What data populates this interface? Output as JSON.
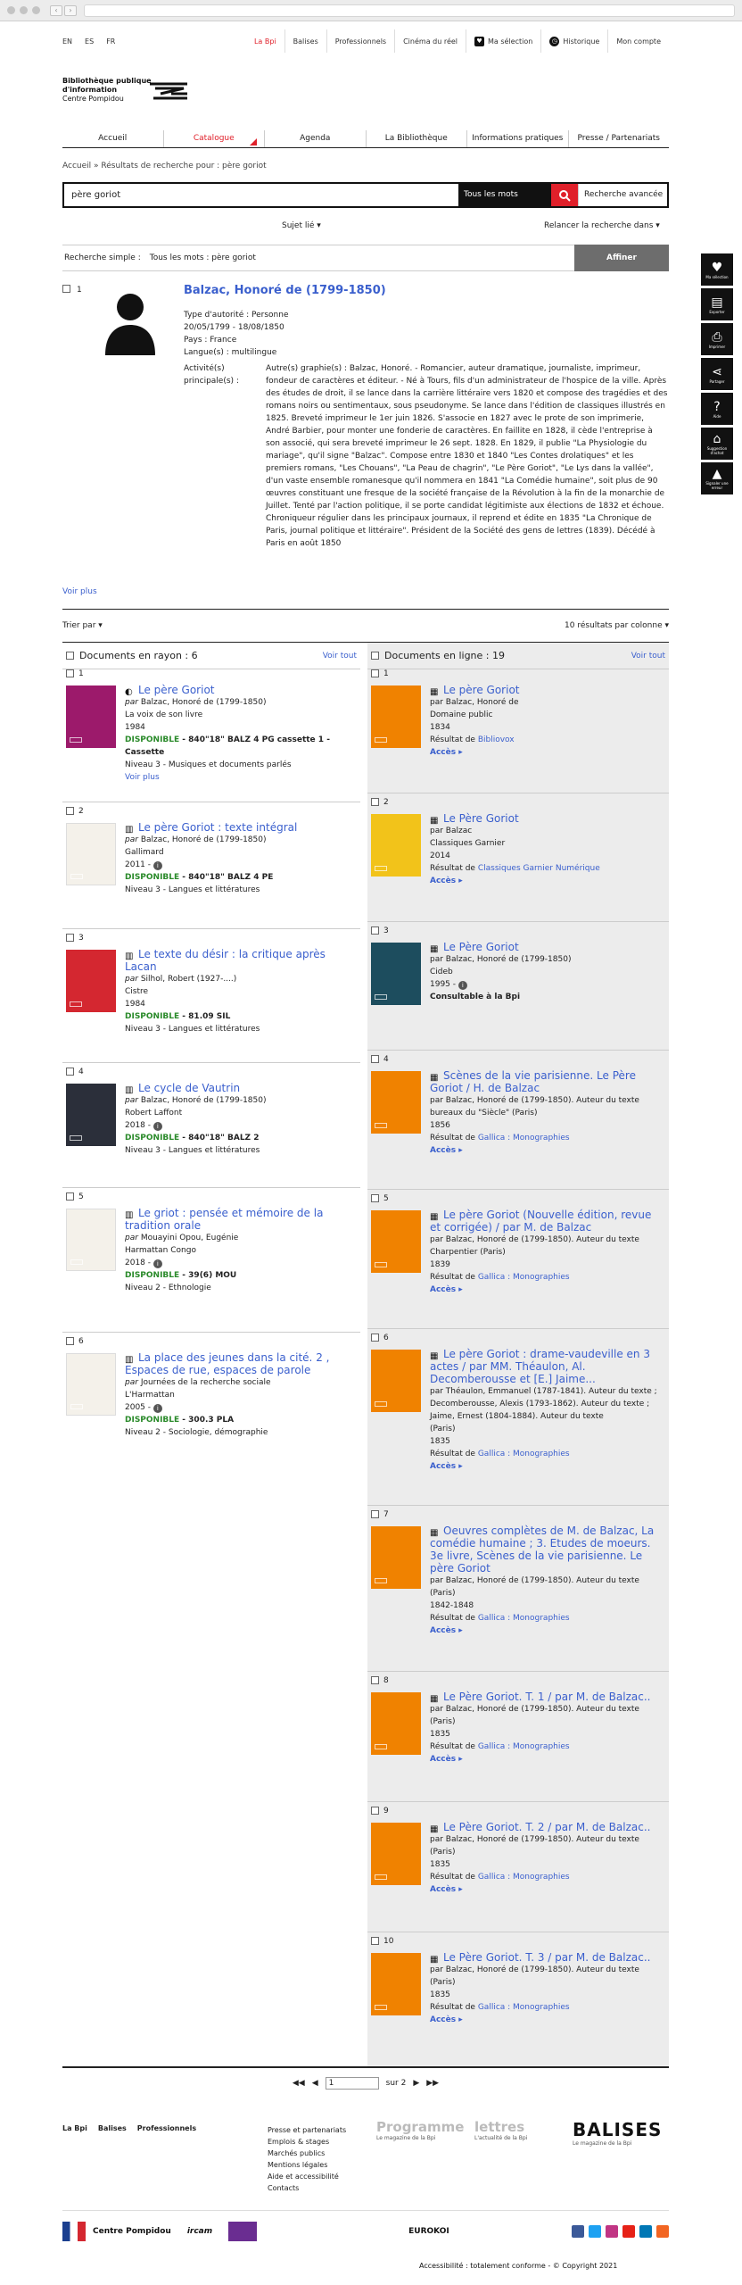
{
  "langs": [
    "EN",
    "ES",
    "FR"
  ],
  "topnav": {
    "items": [
      "La Bpi",
      "Balises",
      "Professionnels",
      "Cinéma du réel"
    ],
    "selection": "Ma sélection",
    "history": "Historique",
    "account": "Mon compte"
  },
  "logo": {
    "line1": "Bibliothèque publique",
    "line2": "d'information",
    "line3": "Centre Pompidou"
  },
  "mainmenu": [
    "Accueil",
    "Catalogue",
    "Agenda",
    "La Bibliothèque",
    "Informations pratiques",
    "Presse / Partenariats"
  ],
  "breadcrumb": "Accueil  »  Résultats de recherche pour : père goriot",
  "search": {
    "query": "père goriot",
    "mode": "Tous les mots",
    "advanced": "Recherche avancée"
  },
  "filters": {
    "subject": "Sujet lié ▾",
    "relaunch": "Relancer la recherche dans ▾"
  },
  "refine": {
    "label": "Recherche simple :",
    "value": "Tous les mots : père goriot",
    "button": "Affiner"
  },
  "sidebar": [
    "Ma sélection",
    "Exporter",
    "Imprimer",
    "Partager",
    "Aide",
    "Suggestion d'achat",
    "Signaler une erreur"
  ],
  "authority": {
    "num": "1",
    "title": "Balzac, Honoré de (1799-1850)",
    "meta": [
      "Type d'autorité : Personne",
      "20/05/1799 - 18/08/1850",
      "Pays : France",
      "Langue(s) : multilingue"
    ],
    "activity_label": "Activité(s) principale(s) :",
    "activity": "Autre(s) graphie(s) : Balzac, Honoré. - Romancier, auteur dramatique, journaliste, imprimeur, fondeur de caractères et éditeur. - Né à Tours, fils d'un administrateur de l'hospice de la ville. Après des études de droit, il se lance dans la carrière littéraire vers 1820 et compose des tragédies et des romans noirs ou sentimentaux, sous pseudonyme. Se lance dans l'édition de classiques illustrés en 1825. Breveté imprimeur le 1er juin 1826. S'associe en 1827 avec le prote de son imprimerie, André Barbier, pour monter une fonderie de caractères. En faillite en 1828, il cède l'entreprise à son associé, qui sera breveté imprimeur le 26 sept. 1828. En 1829, il publie \"La Physiologie du mariage\", qu'il signe \"Balzac\". Compose entre 1830 et 1840 \"Les Contes drolatiques\" et les premiers romans, \"Les Chouans\", \"La Peau de chagrin\", \"Le Père Goriot\", \"Le Lys dans la vallée\", d'un vaste ensemble romanesque qu'il nommera en 1841 \"La Comédie humaine\", soit plus de 90 œuvres constituant une fresque de la société française de la Révolution à la fin de la monarchie de Juillet. Tenté par l'action politique, il se porte candidat légitimiste aux élections de 1832 et échoue. Chroniqueur régulier dans les principaux journaux, il reprend et édite en 1835 \"La Chronique de Paris, journal politique et littéraire\". Président de la Société des gens de lettres (1839). Décédé à Paris en août 1850",
    "more": "Voir plus"
  },
  "sort": {
    "label": "Trier par ▾",
    "per_column": "10 résultats par colonne ▾"
  },
  "left": {
    "title": "Documents en rayon : 6",
    "see_all": "Voir tout",
    "items": [
      {
        "n": "1",
        "title": "Le père Goriot",
        "by": "Balzac, Honoré de (1799-1850)",
        "pub": "La voix de son livre",
        "year": "1984",
        "dispo": "DISPONIBLE",
        "cote": " - 840\"18\" BALZ 4 PG cassette 1 - Cassette",
        "level": "Niveau 3 - Musiques et documents parlés",
        "more": "Voir plus"
      },
      {
        "n": "2",
        "title": "Le père Goriot : texte intégral",
        "by": "Balzac, Honoré de (1799-1850)",
        "pub": "Gallimard",
        "year": "2011 -",
        "dispo": "DISPONIBLE",
        "cote": " - 840\"18\" BALZ 4 PE",
        "level": "Niveau 3 - Langues et littératures"
      },
      {
        "n": "3",
        "title": "Le texte du désir : la critique après Lacan",
        "by": "Silhol, Robert (1927-....)",
        "pub": "Cistre",
        "year": "1984",
        "dispo": "DISPONIBLE",
        "cote": " - 81.09 SIL",
        "level": "Niveau 3 - Langues et littératures"
      },
      {
        "n": "4",
        "title": "Le cycle de Vautrin",
        "by": "Balzac, Honoré de (1799-1850)",
        "pub": "Robert Laffont",
        "year": "2018 -",
        "dispo": "DISPONIBLE",
        "cote": " - 840\"18\" BALZ 2",
        "level": "Niveau 3 - Langues et littératures"
      },
      {
        "n": "5",
        "title": "Le griot : pensée et mémoire de la tradition orale",
        "by": "Mouayini Opou, Eugénie",
        "pub": "Harmattan Congo",
        "year": "2018 -",
        "dispo": "DISPONIBLE",
        "cote": " - 39(6) MOU",
        "level": "Niveau 2 - Ethnologie"
      },
      {
        "n": "6",
        "title": "La place des jeunes dans la cité. 2 , Espaces de rue, espaces de parole",
        "by": "Journées de la recherche sociale",
        "pub": "L'Harmattan",
        "year": "2005 -",
        "dispo": "DISPONIBLE",
        "cote": " - 300.3 PLA",
        "level": "Niveau 2 - Sociologie, démographie"
      }
    ]
  },
  "right": {
    "title": "Documents en ligne : 19",
    "see_all": "Voir tout",
    "items": [
      {
        "n": "1",
        "title": "Le père Goriot",
        "lines": [
          "par Balzac, Honoré de",
          "Domaine public",
          "1834"
        ],
        "src_label": "Résultat de ",
        "src": "Bibliovox",
        "access": "Accès ▸"
      },
      {
        "n": "2",
        "title": "Le Père Goriot",
        "lines": [
          "par Balzac",
          "Classiques Garnier",
          "2014"
        ],
        "src_label": "Résultat de ",
        "src": "Classiques Garnier Numérique",
        "access": "Accès ▸"
      },
      {
        "n": "3",
        "title": "Le Père Goriot",
        "lines": [
          "par Balzac, Honoré de (1799-1850)",
          "Cideb",
          "1995 -"
        ],
        "src_label": "",
        "src": "",
        "access": "Consultable à la Bpi"
      },
      {
        "n": "4",
        "title": "Scènes de la vie parisienne. Le Père Goriot / H. de Balzac",
        "lines": [
          "par Balzac, Honoré de (1799-1850). Auteur du texte",
          "bureaux du \"Siècle\" (Paris)",
          "1856"
        ],
        "src_label": "Résultat de ",
        "src": "Gallica : Monographies",
        "access": "Accès ▸"
      },
      {
        "n": "5",
        "title": "Le père Goriot (Nouvelle édition, revue et corrigée) / par M. de Balzac",
        "lines": [
          "par Balzac, Honoré de (1799-1850). Auteur du texte",
          "Charpentier (Paris)",
          "1839"
        ],
        "src_label": "Résultat de ",
        "src": "Gallica : Monographies",
        "access": "Accès ▸"
      },
      {
        "n": "6",
        "title": "Le père Goriot : drame-vaudeville en 3 actes / par MM. Théaulon, Al. Decomberousse et [E.] Jaime...",
        "lines": [
          "par Théaulon, Emmanuel (1787-1841). Auteur du texte ; Decomberousse, Alexis (1793-1862). Auteur du texte ; Jaime, Ernest (1804-1884). Auteur du texte",
          "(Paris)",
          "1835"
        ],
        "src_label": "Résultat de ",
        "src": "Gallica : Monographies",
        "access": "Accès ▸"
      },
      {
        "n": "7",
        "title": "Oeuvres complètes de M. de Balzac, La comédie humaine ; 3. Etudes de moeurs. 3e livre, Scènes de la vie parisienne. Le père Goriot",
        "lines": [
          "par Balzac, Honoré de (1799-1850). Auteur du texte",
          "(Paris)",
          "1842-1848"
        ],
        "src_label": "Résultat de ",
        "src": "Gallica : Monographies",
        "access": "Accès ▸"
      },
      {
        "n": "8",
        "title": "Le Père Goriot. T. 1 / par M. de Balzac..",
        "lines": [
          "par Balzac, Honoré de (1799-1850). Auteur du texte",
          "(Paris)",
          "1835"
        ],
        "src_label": "Résultat de ",
        "src": "Gallica : Monographies",
        "access": "Accès ▸"
      },
      {
        "n": "9",
        "title": "Le Père Goriot. T. 2 / par M. de Balzac..",
        "lines": [
          "par Balzac, Honoré de (1799-1850). Auteur du texte",
          "(Paris)",
          "1835"
        ],
        "src_label": "Résultat de ",
        "src": "Gallica : Monographies",
        "access": "Accès ▸"
      },
      {
        "n": "10",
        "title": "Le Père Goriot. T. 3 / par M. de Balzac..",
        "lines": [
          "par Balzac, Honoré de (1799-1850). Auteur du texte",
          "(Paris)",
          "1835"
        ],
        "src_label": "Résultat de ",
        "src": "Gallica : Monographies",
        "access": "Accès ▸"
      }
    ]
  },
  "pager": {
    "page": "1",
    "total": "sur 2"
  },
  "footer": {
    "nav": [
      "La Bpi",
      "Balises",
      "Professionnels"
    ],
    "links": [
      "Presse et partenariats",
      "Emplois & stages",
      "Marchés publics",
      "Mentions légales",
      "Aide et accessibilité",
      "Contacts"
    ],
    "prog_big": "Programme",
    "prog": "Le magazine de la Bpi",
    "lettres_big": "lettres",
    "lettres": "L'actualité de la Bpi",
    "balises": "BALISES",
    "balises_sub": "Le magazine de la Bpi"
  },
  "partners": [
    "Centre Pompidou",
    "ircam",
    "EUROKOI"
  ],
  "copyright": "Accessibilité : totalement conforme  -  © Copyright 2021"
}
